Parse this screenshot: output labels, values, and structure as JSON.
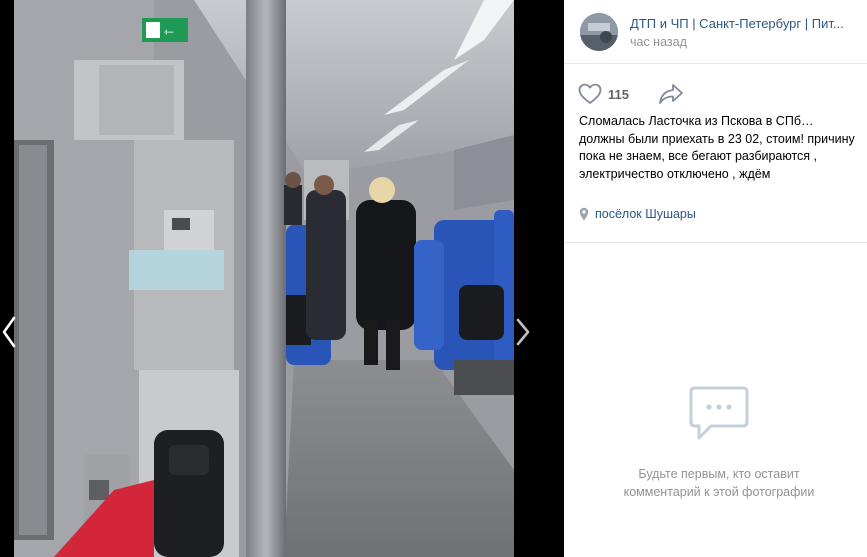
{
  "post": {
    "group_name": "ДТП и ЧП | Санкт-Петербург | Пит...",
    "time": "час назад",
    "likes": "115",
    "caption": "Сломалась Ласточка из Пскова в СПб… должны были приехать в 23 02, стоим! причину пока не знаем, все бегают разбираются , электричество отключено , ждём",
    "location": "посёлок Шушары"
  },
  "comments": {
    "empty_line1": "Будьте первым, кто оставит",
    "empty_line2": "комментарий к этой фотографии"
  },
  "icons": {
    "like": "heart-outline-icon",
    "share": "share-arrow-icon",
    "location": "location-pin-icon",
    "empty": "comment-bubble-icon",
    "prev": "chevron-left-icon",
    "next": "chevron-right-icon"
  },
  "colors": {
    "link": "#2a5885",
    "muted": "#939393",
    "seat_blue": "#2a55b8"
  }
}
